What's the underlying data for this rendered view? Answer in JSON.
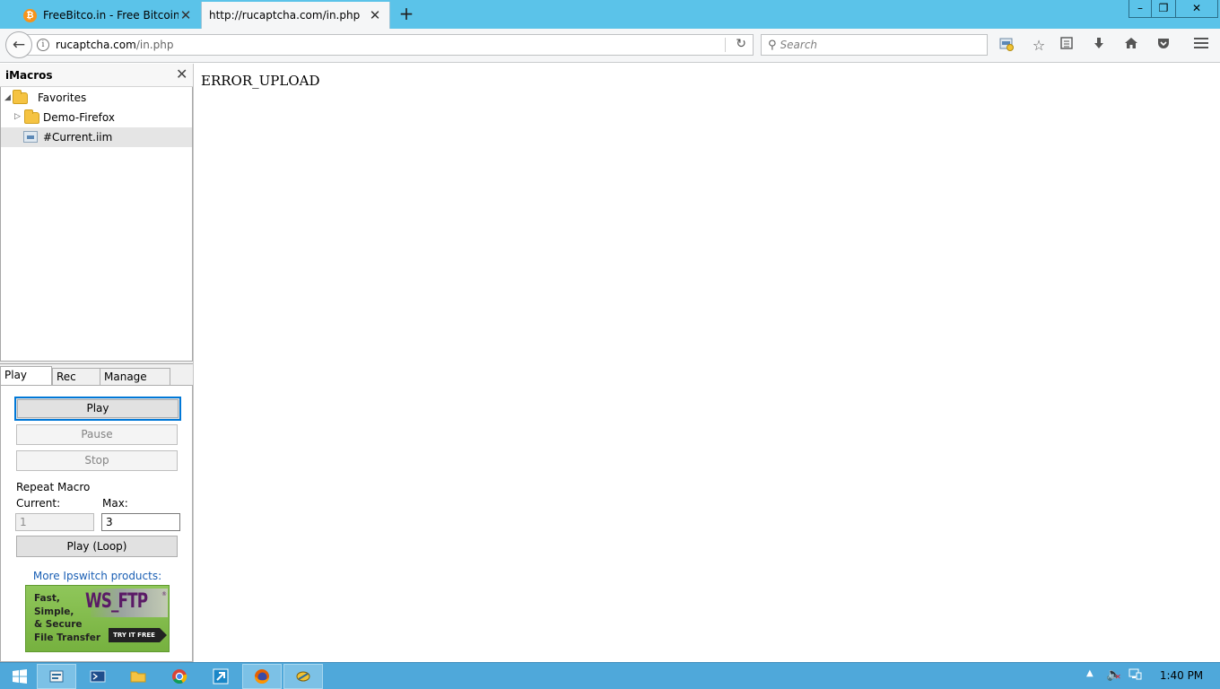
{
  "browser": {
    "tabs": [
      {
        "title": "FreeBitco.in - Free Bitcoin ...",
        "favicon": "bitcoin-icon",
        "active": false
      },
      {
        "title": "http://rucaptcha.com/in.php",
        "active": true
      }
    ],
    "new_tab": "+",
    "window_controls": {
      "minimize": "–",
      "maximize": "❐",
      "close": "✕"
    },
    "url": {
      "domain": "rucaptcha.com",
      "path": "/in.php"
    },
    "search_placeholder": "Search",
    "toolbar_icons": [
      "imacros-icon",
      "bookmark-star-icon",
      "reading-list-icon",
      "download-icon",
      "home-icon",
      "pocket-icon",
      "menu-icon"
    ],
    "accent_color": "#5bc3e9"
  },
  "imacros": {
    "title": "iMacros",
    "close": "✕",
    "tree": [
      {
        "label": "Favorites",
        "type": "folder",
        "expanded": true
      },
      {
        "label": "Demo-Firefox",
        "type": "folder",
        "expanded": false
      },
      {
        "label": "#Current.iim",
        "type": "macro",
        "selected": true
      }
    ],
    "tabs": [
      "Play",
      "Rec",
      "Manage"
    ],
    "active_tab": "Play",
    "buttons": {
      "play": "Play",
      "pause": "Pause",
      "stop": "Stop",
      "play_loop": "Play (Loop)"
    },
    "repeat_label": "Repeat Macro",
    "current_label": "Current:",
    "max_label": "Max:",
    "current_value": "1",
    "max_value": "3",
    "more_products": "More Ipswitch products:",
    "ad": {
      "logo": "WS_FTP",
      "logo_mark": "®",
      "lines": [
        "Fast,",
        "Simple,",
        "& Secure",
        "File Transfer"
      ],
      "cta": "TRY IT FREE"
    }
  },
  "page": {
    "text": "ERROR_UPLOAD"
  },
  "taskbar": {
    "apps": [
      "windows-start-icon",
      "file-manager-icon",
      "powershell-icon",
      "folder-icon",
      "chrome-icon",
      "shortcut-icon",
      "firefox-icon",
      "app-icon"
    ],
    "clock": "1:40 PM"
  }
}
